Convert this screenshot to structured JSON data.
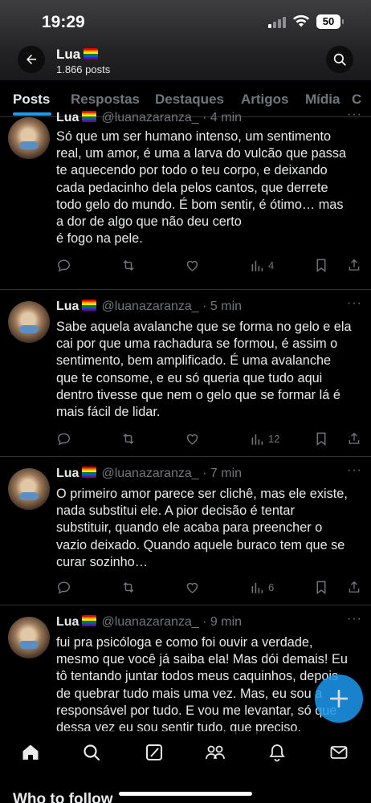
{
  "status_bar": {
    "time": "19:29",
    "battery": "50"
  },
  "header": {
    "name": "Lua",
    "posts_count": "1.866 posts"
  },
  "tabs": [
    {
      "label": "Posts",
      "active": true
    },
    {
      "label": "Respostas"
    },
    {
      "label": "Destaques"
    },
    {
      "label": "Artigos"
    },
    {
      "label": "Mídia"
    },
    {
      "label": "C"
    }
  ],
  "tweets": [
    {
      "name": "Lua",
      "handle": "@luanazaranza_",
      "time": "· 4 min",
      "text": "Só que um ser humano intenso, um sentimento\nreal, um amor, é uma a larva do vulcão que passa\nte aquecendo por todo o teu corpo, e deixando\ncada pedacinho dela pelos cantos, que derrete\ntodo gelo do mundo. É bom sentir, é ótimo… mas\na dor de algo que não deu certo\né fogo na pele.",
      "views": "4"
    },
    {
      "name": "Lua",
      "handle": "@luanazaranza_",
      "time": "· 5 min",
      "text": "Sabe aquela avalanche que se forma no gelo e ela\ncai por que uma rachadura se formou, é assim o\nsentimento, bem amplificado. É uma avalanche\nque te consome, e eu só queria que tudo aqui\ndentro tivesse que nem o gelo que se formar lá é\nmais fácil de lidar.",
      "views": "12"
    },
    {
      "name": "Lua",
      "handle": "@luanazaranza_",
      "time": "· 7 min",
      "text": "O primeiro amor parece ser clichê, mas ele existe,\nnada substitui ele. A pior decisão é tentar\nsubstituir, quando ele acaba para preencher o\nvazio deixado. Quando aquele buraco tem que se\ncurar sozinho…",
      "views": "6"
    },
    {
      "name": "Lua",
      "handle": "@luanazaranza_",
      "time": "· 9 min",
      "text": "fui pra psicóloga e como foi ouvir a verdade,\nmesmo que você já saiba ela! Mas dói demais! Eu\ntô tentando juntar todos meus caquinhos, depois\nde quebrar tudo mais uma vez. Mas, eu sou a\nresponsável por tudo. E vou me levantar, só que\ndessa vez eu sou sentir tudo, que preciso.",
      "views": ""
    }
  ],
  "footer": {
    "who_to_follow": "Who to follow"
  },
  "colors": {
    "accent": "#1d9bf0",
    "background": "#000000",
    "muted": "#71767b"
  },
  "icons": {
    "header": [
      "back-arrow-icon",
      "search-icon"
    ],
    "tweet_actions": [
      "reply-icon",
      "retweet-icon",
      "like-icon",
      "views-icon",
      "bookmark-icon",
      "share-icon"
    ],
    "nav": [
      "home-icon",
      "search-icon",
      "grok-icon",
      "communities-icon",
      "notifications-icon",
      "messages-icon"
    ],
    "fab": "compose-plus-icon"
  }
}
